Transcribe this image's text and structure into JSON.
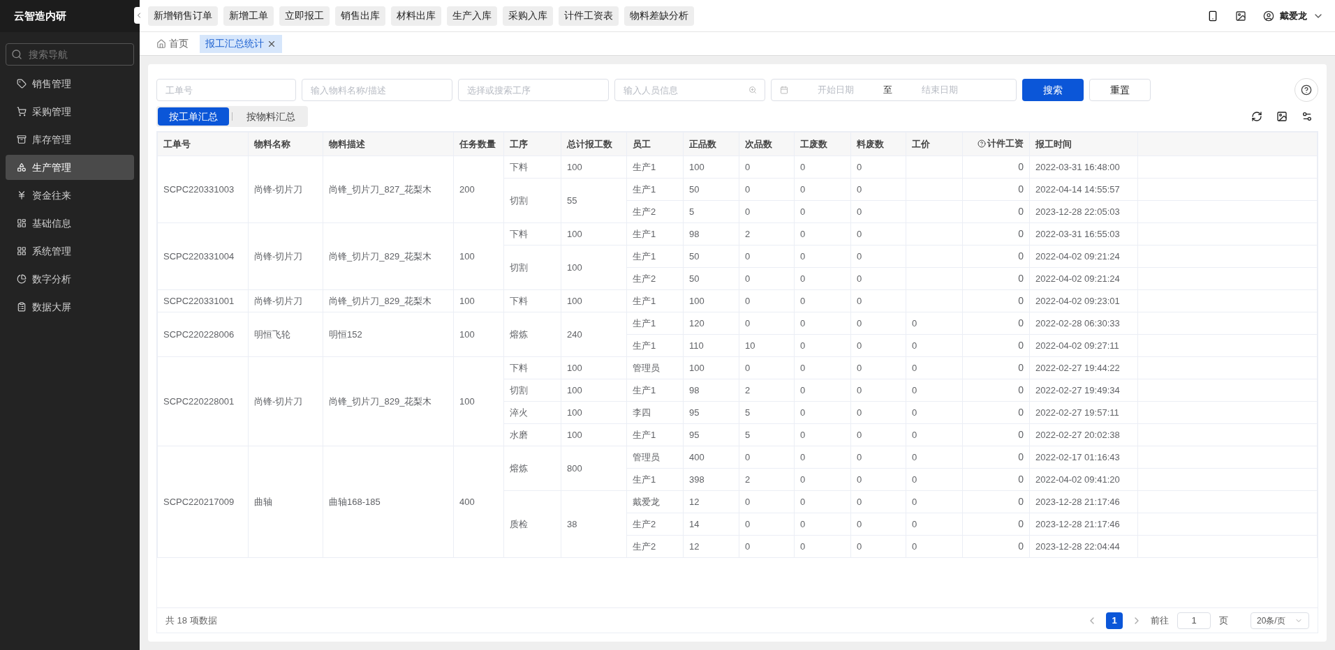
{
  "brand": "云智造内研",
  "sidebar": {
    "search_placeholder": "搜索导航",
    "items": [
      {
        "label": "销售管理",
        "selected": false
      },
      {
        "label": "采购管理",
        "selected": false
      },
      {
        "label": "库存管理",
        "selected": false
      },
      {
        "label": "生产管理",
        "selected": true
      },
      {
        "label": "资金往来",
        "selected": false
      },
      {
        "label": "基础信息",
        "selected": false
      },
      {
        "label": "系统管理",
        "selected": false
      },
      {
        "label": "数字分析",
        "selected": false
      },
      {
        "label": "数据大屏",
        "selected": false
      }
    ]
  },
  "quick_actions": [
    "新增销售订单",
    "新增工单",
    "立即报工",
    "销售出库",
    "材料出库",
    "生产入库",
    "采购入库",
    "计件工资表",
    "物料差缺分析"
  ],
  "user": {
    "name": "戴爱龙"
  },
  "tabs": [
    {
      "label": "首页",
      "selected": false,
      "closable": false
    },
    {
      "label": "报工汇总统计",
      "selected": true,
      "closable": true
    }
  ],
  "filters": {
    "order_placeholder": "工单号",
    "material_placeholder": "输入物料名称/描述",
    "process_placeholder": "选择或搜索工序",
    "person_placeholder": "输入人员信息",
    "start_placeholder": "开始日期",
    "range_separator": "至",
    "end_placeholder": "结束日期",
    "search_button": "搜索",
    "reset_button": "重置"
  },
  "view_toggle": [
    {
      "label": "按工单汇总",
      "selected": true
    },
    {
      "label": "按物料汇总",
      "selected": false
    }
  ],
  "table": {
    "columns": [
      "工单号",
      "物料名称",
      "物料描述",
      "任务数量",
      "工序",
      "总计报工数",
      "员工",
      "正品数",
      "次品数",
      "工废数",
      "料废数",
      "工价",
      "计件工资",
      "报工时间"
    ],
    "orders": [
      {
        "order_no": "SCPC220331003",
        "material_name": "尚锋-切片刀",
        "material_desc": "尚锋_切片刀_827_花梨木",
        "task_qty": "200",
        "processes": [
          {
            "process": "下料",
            "total": "100",
            "entries": [
              {
                "employee": "生产1",
                "good": "100",
                "defect": "0",
                "labor_scrap": "0",
                "material_scrap": "0",
                "wage": "0",
                "time": "2022-03-31 16:48:00"
              }
            ]
          },
          {
            "process": "切割",
            "total": "55",
            "entries": [
              {
                "employee": "生产1",
                "good": "50",
                "defect": "0",
                "labor_scrap": "0",
                "material_scrap": "0",
                "wage": "0",
                "time": "2022-04-14 14:55:57"
              },
              {
                "employee": "生产2",
                "good": "5",
                "defect": "0",
                "labor_scrap": "0",
                "material_scrap": "0",
                "wage": "0",
                "time": "2023-12-28 22:05:03"
              }
            ]
          }
        ]
      },
      {
        "order_no": "SCPC220331004",
        "material_name": "尚锋-切片刀",
        "material_desc": "尚锋_切片刀_829_花梨木",
        "task_qty": "100",
        "processes": [
          {
            "process": "下料",
            "total": "100",
            "entries": [
              {
                "employee": "生产1",
                "good": "98",
                "defect": "2",
                "labor_scrap": "0",
                "material_scrap": "0",
                "wage": "0",
                "time": "2022-03-31 16:55:03"
              }
            ]
          },
          {
            "process": "切割",
            "total": "100",
            "entries": [
              {
                "employee": "生产1",
                "good": "50",
                "defect": "0",
                "labor_scrap": "0",
                "material_scrap": "0",
                "wage": "0",
                "time": "2022-04-02 09:21:24"
              },
              {
                "employee": "生产2",
                "good": "50",
                "defect": "0",
                "labor_scrap": "0",
                "material_scrap": "0",
                "wage": "0",
                "time": "2022-04-02 09:21:24"
              }
            ]
          }
        ]
      },
      {
        "order_no": "SCPC220331001",
        "material_name": "尚锋-切片刀",
        "material_desc": "尚锋_切片刀_829_花梨木",
        "task_qty": "100",
        "processes": [
          {
            "process": "下料",
            "total": "100",
            "entries": [
              {
                "employee": "生产1",
                "good": "100",
                "defect": "0",
                "labor_scrap": "0",
                "material_scrap": "0",
                "wage": "0",
                "time": "2022-04-02 09:23:01"
              }
            ]
          }
        ]
      },
      {
        "order_no": "SCPC220228006",
        "material_name": "明恒飞轮",
        "material_desc": "明恒152",
        "task_qty": "100",
        "processes": [
          {
            "process": "熔炼",
            "total": "240",
            "entries": [
              {
                "employee": "生产1",
                "good": "120",
                "defect": "0",
                "labor_scrap": "0",
                "material_scrap": "0",
                "price": "0",
                "wage": "0",
                "time": "2022-02-28 06:30:33"
              },
              {
                "employee": "生产1",
                "good": "110",
                "defect": "10",
                "labor_scrap": "0",
                "material_scrap": "0",
                "price": "0",
                "wage": "0",
                "time": "2022-04-02 09:27:11"
              }
            ]
          }
        ]
      },
      {
        "order_no": "SCPC220228001",
        "material_name": "尚锋-切片刀",
        "material_desc": "尚锋_切片刀_829_花梨木",
        "task_qty": "100",
        "processes": [
          {
            "process": "下料",
            "total": "100",
            "entries": [
              {
                "employee": "管理员",
                "good": "100",
                "defect": "0",
                "labor_scrap": "0",
                "material_scrap": "0",
                "price": "0",
                "wage": "0",
                "time": "2022-02-27 19:44:22"
              }
            ]
          },
          {
            "process": "切割",
            "total": "100",
            "entries": [
              {
                "employee": "生产1",
                "good": "98",
                "defect": "2",
                "labor_scrap": "0",
                "material_scrap": "0",
                "price": "0",
                "wage": "0",
                "time": "2022-02-27 19:49:34"
              }
            ]
          },
          {
            "process": "淬火",
            "total": "100",
            "entries": [
              {
                "employee": "李四",
                "good": "95",
                "defect": "5",
                "labor_scrap": "0",
                "material_scrap": "0",
                "price": "0",
                "wage": "0",
                "time": "2022-02-27 19:57:11"
              }
            ]
          },
          {
            "process": "水磨",
            "total": "100",
            "entries": [
              {
                "employee": "生产1",
                "good": "95",
                "defect": "5",
                "labor_scrap": "0",
                "material_scrap": "0",
                "price": "0",
                "wage": "0",
                "time": "2022-02-27 20:02:38"
              }
            ]
          }
        ]
      },
      {
        "order_no": "SCPC220217009",
        "material_name": "曲轴",
        "material_desc": "曲轴168-185",
        "task_qty": "400",
        "processes": [
          {
            "process": "熔炼",
            "total": "800",
            "entries": [
              {
                "employee": "管理员",
                "good": "400",
                "defect": "0",
                "labor_scrap": "0",
                "material_scrap": "0",
                "price": "0",
                "wage": "0",
                "time": "2022-02-17 01:16:43"
              },
              {
                "employee": "生产1",
                "good": "398",
                "defect": "2",
                "labor_scrap": "0",
                "material_scrap": "0",
                "price": "0",
                "wage": "0",
                "time": "2022-04-02 09:41:20"
              }
            ]
          },
          {
            "process": "质检",
            "total": "38",
            "entries": [
              {
                "employee": "戴爱龙",
                "good": "12",
                "defect": "0",
                "labor_scrap": "0",
                "material_scrap": "0",
                "price": "0",
                "wage": "0",
                "time": "2023-12-28 21:17:46"
              },
              {
                "employee": "生产2",
                "good": "14",
                "defect": "0",
                "labor_scrap": "0",
                "material_scrap": "0",
                "price": "0",
                "wage": "0",
                "time": "2023-12-28 21:17:46"
              },
              {
                "employee": "生产2",
                "good": "12",
                "defect": "0",
                "labor_scrap": "0",
                "material_scrap": "0",
                "price": "0",
                "wage": "0",
                "time": "2023-12-28 22:04:44"
              }
            ]
          }
        ]
      }
    ]
  },
  "footer": {
    "total": "共 18 项数据",
    "pages": [
      {
        "label": "1",
        "selected": true
      }
    ],
    "goto_label": "前往",
    "goto_value": "1",
    "page_unit": "页",
    "page_size": "20条/页"
  }
}
